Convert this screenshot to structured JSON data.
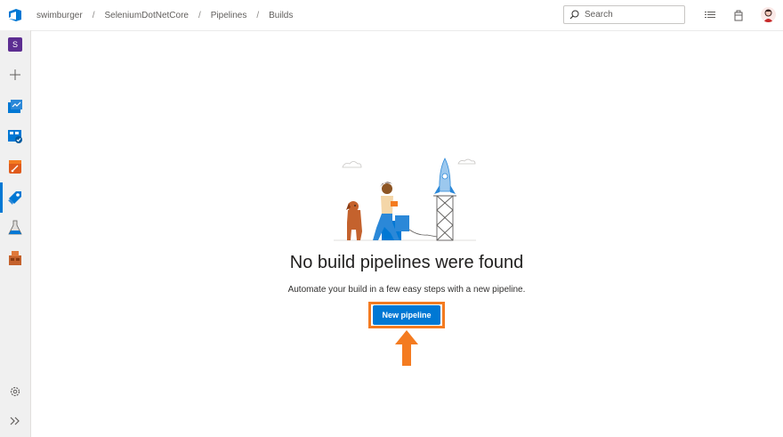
{
  "breadcrumb": {
    "items": [
      "swimburger",
      "SeleniumDotNetCore",
      "Pipelines",
      "Builds"
    ],
    "separator": "/"
  },
  "search": {
    "placeholder": "Search"
  },
  "leftnav": {
    "project_initial": "S",
    "items": [
      "project",
      "new",
      "overview",
      "boards",
      "repos",
      "pipelines",
      "test-plans",
      "artifacts"
    ],
    "active": "pipelines"
  },
  "empty_state": {
    "title": "No build pipelines were found",
    "description": "Automate your build in a few easy steps with a new pipeline.",
    "button_label": "New pipeline"
  },
  "colors": {
    "accent": "#0078d4",
    "highlight": "#f47b20",
    "project_badge": "#5c2d91"
  }
}
